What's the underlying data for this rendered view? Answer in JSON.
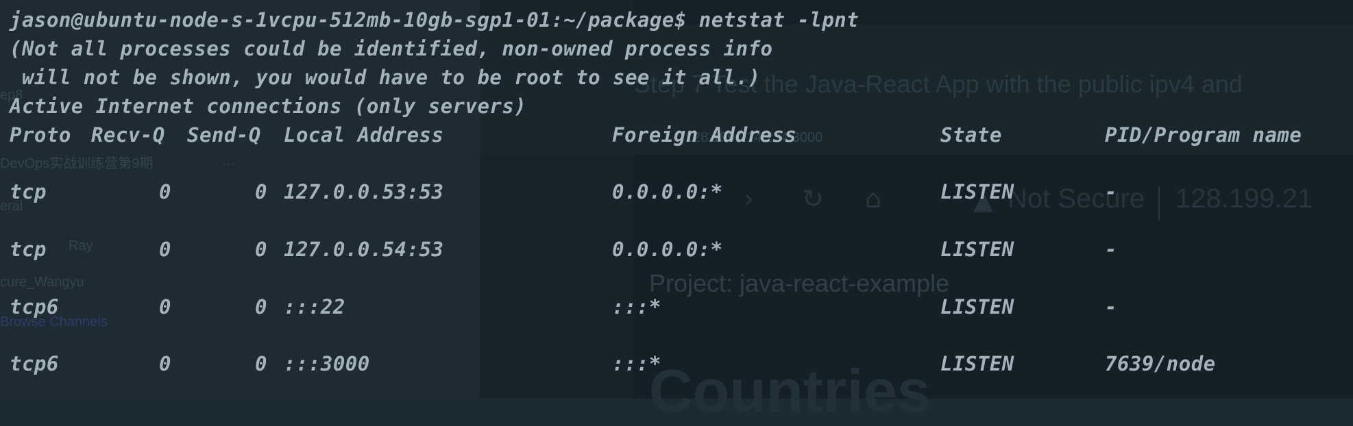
{
  "terminal": {
    "prompt_user_host": "jason@ubuntu-node-s-1vcpu-512mb-10gb-sgp1-01",
    "prompt_path": ":~/package$",
    "command": " netstat -lpnt",
    "warning_line1": "(Not all processes could be identified, non-owned process info",
    "warning_line2": " will not be shown, you would have to be root to see it all.)",
    "section_title": "Active Internet connections (only servers)",
    "columns": [
      "Proto",
      "Recv-Q",
      "Send-Q",
      "Local Address",
      "Foreign Address",
      "State",
      "PID/Program name"
    ],
    "rows": [
      {
        "proto": "tcp",
        "recvq": "0",
        "sendq": "0",
        "local": "127.0.0.53:53",
        "foreign": "0.0.0.0:*",
        "state": "LISTEN",
        "pid": "-"
      },
      {
        "proto": "tcp",
        "recvq": "0",
        "sendq": "0",
        "local": "127.0.0.54:53",
        "foreign": "0.0.0.0:*",
        "state": "LISTEN",
        "pid": "-"
      },
      {
        "proto": "tcp6",
        "recvq": "0",
        "sendq": "0",
        "local": ":::22",
        "foreign": ":::*",
        "state": "LISTEN",
        "pid": "-"
      },
      {
        "proto": "tcp6",
        "recvq": "0",
        "sendq": "0",
        "local": ":::3000",
        "foreign": ":::*",
        "state": "LISTEN",
        "pid": "7639/node"
      }
    ]
  },
  "background": {
    "sidebar_items": [
      "ep8",
      "DevOps实战训练营第9期",
      "eral",
      "Ray",
      "cure_Wangyu",
      "Browse Channels"
    ],
    "sidebar_more": "...",
    "browser_heading": "Step 7 Test the Java-React App with the public ipv4 and",
    "browser_address_fragment": "128.199.214.234:3000",
    "browser_security": "Not Secure",
    "browser_url": "128.199.21",
    "project_label": "Project: java-react-example",
    "page_title": "Countries"
  },
  "colors": {
    "terminal_text": "#a3b2bd",
    "terminal_bg": "#1c2a31"
  }
}
